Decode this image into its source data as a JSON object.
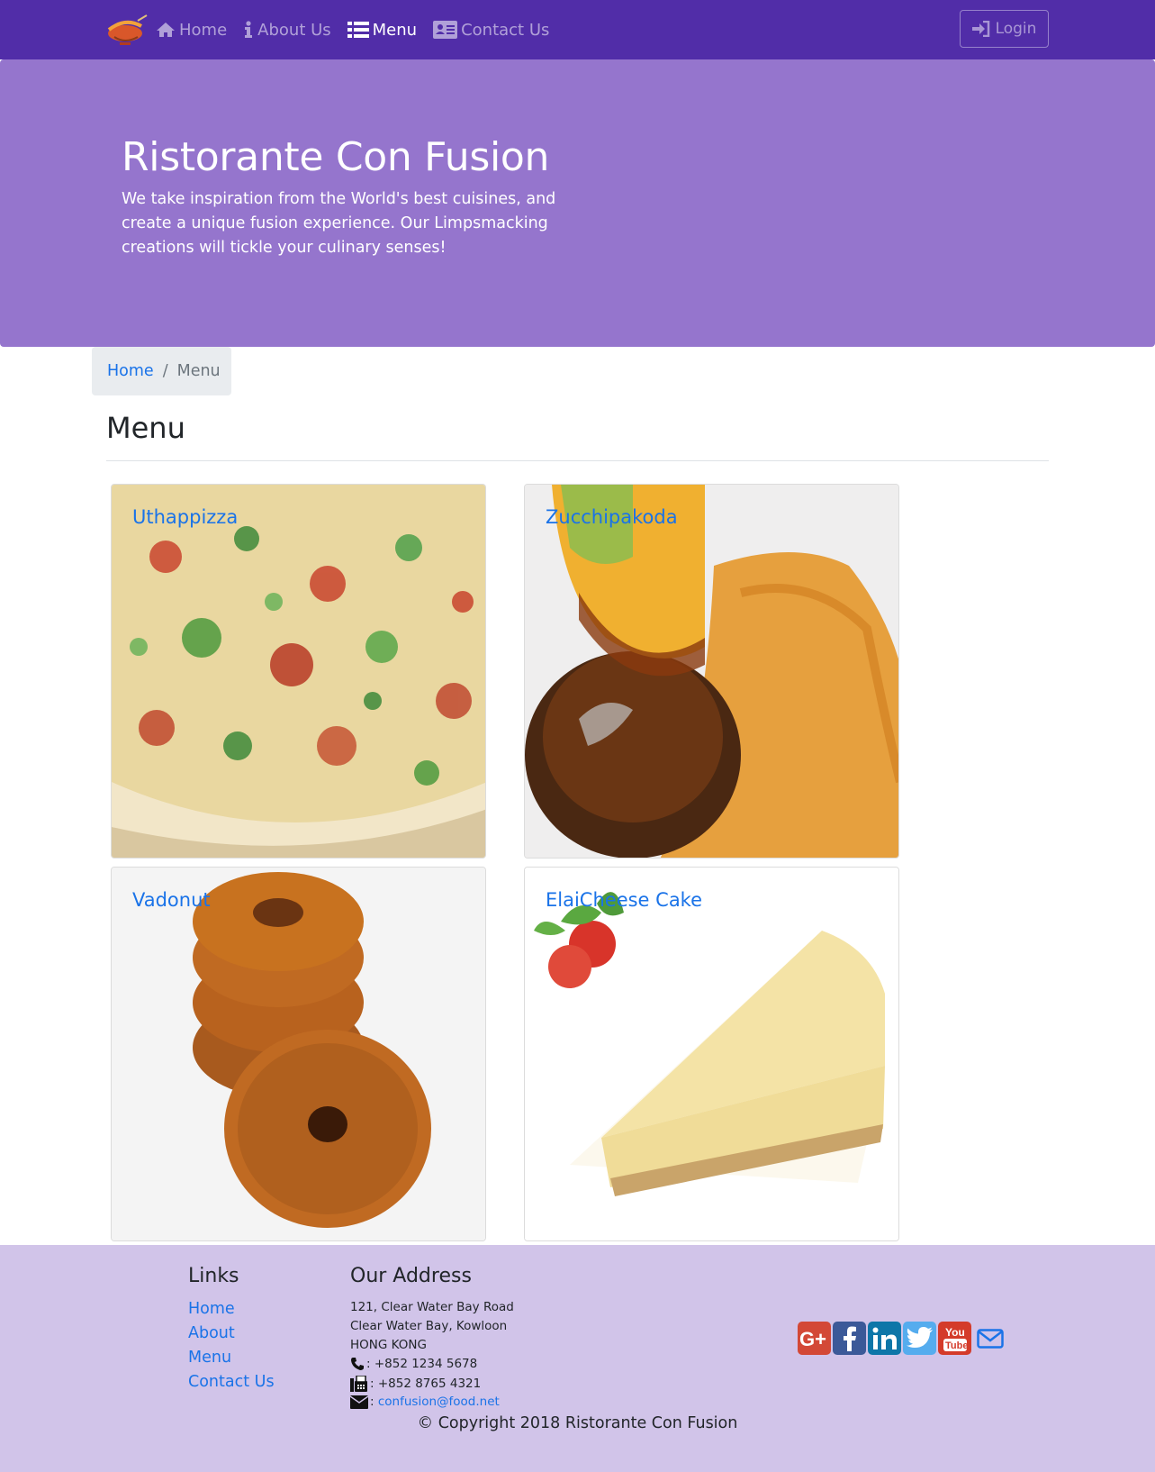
{
  "navbar": {
    "brand_icon": "restaurant-logo-icon",
    "items": [
      {
        "label": "Home",
        "icon": "home-icon",
        "active": false
      },
      {
        "label": "About Us",
        "icon": "info-icon",
        "active": false
      },
      {
        "label": "Menu",
        "icon": "list-icon",
        "active": true
      },
      {
        "label": "Contact Us",
        "icon": "address-card-icon",
        "active": false
      }
    ],
    "login_label": "Login",
    "background": "#512DA8"
  },
  "jumbotron": {
    "title": "Ristorante Con Fusion",
    "text": "We take inspiration from the World's best cuisines, and create a unique fusion experience. Our Limpsmacking creations will tickle your culinary senses!",
    "background": "#9575CD"
  },
  "breadcrumb": {
    "home": "Home",
    "separator": "/",
    "current": "Menu"
  },
  "page": {
    "title": "Menu"
  },
  "menu": {
    "dishes": [
      {
        "name": "Uthappizza"
      },
      {
        "name": "Zucchipakoda"
      },
      {
        "name": "Vadonut"
      },
      {
        "name": "ElaiCheese Cake"
      }
    ]
  },
  "footer": {
    "links_heading": "Links",
    "links": [
      "Home",
      "About",
      "Menu",
      "Contact Us"
    ],
    "address_heading": "Our Address",
    "address_lines": [
      "121, Clear Water Bay Road",
      "Clear Water Bay, Kowloon",
      "HONG KONG"
    ],
    "phone": ": +852 1234 5678",
    "fax": ": +852 8765 4321",
    "email_prefix": ":",
    "email": "confusion@food.net",
    "socials": [
      "google-plus-icon",
      "facebook-icon",
      "linkedin-icon",
      "twitter-icon",
      "youtube-icon",
      "envelope-icon"
    ],
    "copyright": "© Copyright 2018 Ristorante Con Fusion",
    "background": "#D1C4E9"
  }
}
